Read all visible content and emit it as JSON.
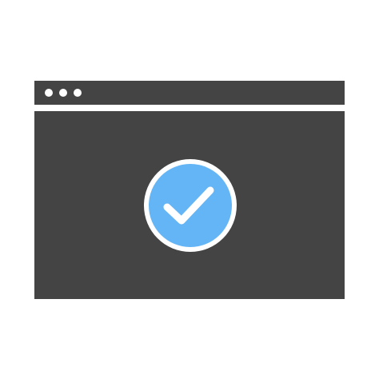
{
  "icon": {
    "name": "browser-window-verified-icon",
    "frame_icon": "browser-window-icon",
    "badge_icon": "checkmark-circle-icon",
    "window_control_icons": [
      "dot-icon",
      "dot-icon",
      "dot-icon"
    ]
  },
  "colors": {
    "background": "#ffffff",
    "window": "#444444",
    "window_dots": "#ffffff",
    "badge_fill": "#64b5f6",
    "badge_ring": "#ffffff",
    "checkmark": "#ffffff"
  }
}
